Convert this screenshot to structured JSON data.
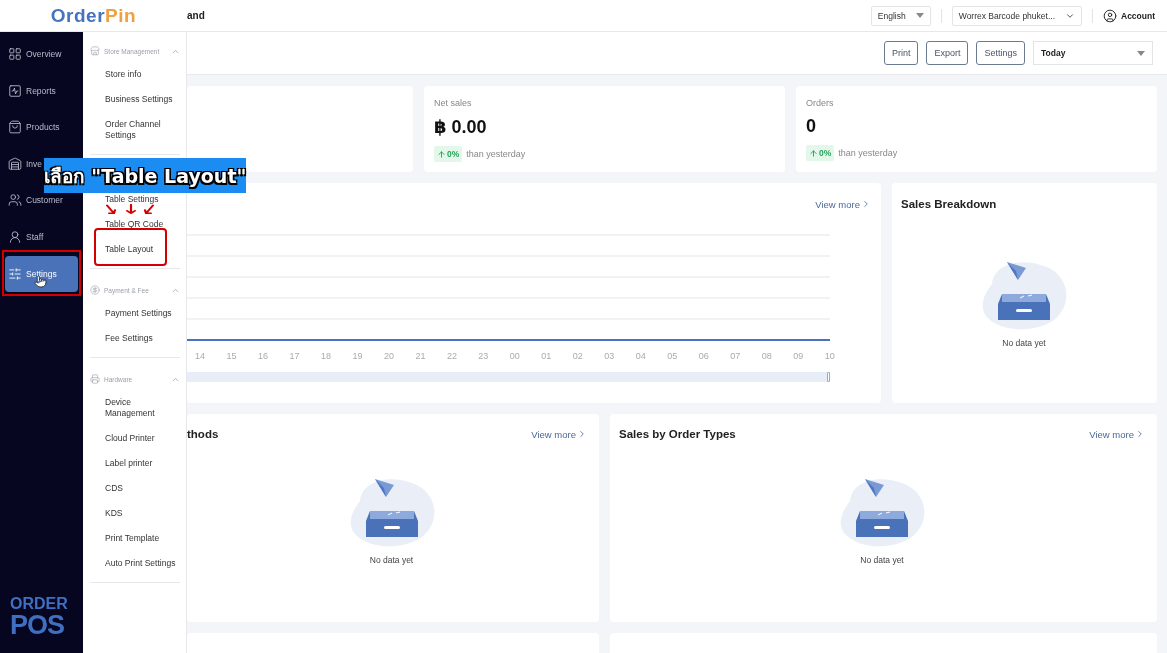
{
  "header": {
    "logo": [
      "Order",
      "Pin"
    ],
    "page_title": "and",
    "language": "English",
    "store": "Worrex Barcode phuket...",
    "account": "Account"
  },
  "sidebar": {
    "items": [
      {
        "label": "Overview",
        "selected": false
      },
      {
        "label": "Reports",
        "selected": false
      },
      {
        "label": "Products",
        "selected": false
      },
      {
        "label": "Inve",
        "selected": false
      },
      {
        "label": "Customer",
        "selected": false
      },
      {
        "label": "Staff",
        "selected": false
      },
      {
        "label": "Settings",
        "selected": true
      }
    ],
    "footer_logo": [
      "ORDER",
      "POS"
    ]
  },
  "submenu": {
    "groups": [
      {
        "title": "Store Management",
        "expanded": true,
        "items": [
          "Store info",
          "Business Settings",
          "Order Channel Settings"
        ]
      },
      {
        "items": [
          "Table Settings",
          "Table QR Code",
          "Table Layout"
        ]
      },
      {
        "title": "Payment & Fee",
        "expanded": true,
        "items": [
          "Payment Settings",
          "Fee Settings"
        ]
      },
      {
        "title": "Hardware",
        "expanded": true,
        "items": [
          "Device Management",
          "Cloud Printer",
          "Label printer",
          "CDS",
          "KDS",
          "Print Template",
          "Auto Print Settings"
        ]
      }
    ]
  },
  "toolbar": {
    "buttons": [
      "Print",
      "Export",
      "Settings"
    ],
    "period": "Today"
  },
  "stats": [
    {
      "kind": "blank"
    },
    {
      "kind": "metric",
      "label": "Net sales",
      "value": "฿ 0.00",
      "change": "0%",
      "note": "than yesterday"
    },
    {
      "kind": "metric",
      "label": "Orders",
      "value": "0",
      "change": "0%",
      "note": "than yesterday"
    }
  ],
  "trend_card": {
    "link": "View more",
    "x_labels": [
      "14",
      "15",
      "16",
      "17",
      "18",
      "19",
      "20",
      "21",
      "22",
      "23",
      "00",
      "01",
      "02",
      "03",
      "04",
      "05",
      "06",
      "07",
      "08",
      "09",
      "10"
    ]
  },
  "breakdown_card": {
    "title": "Sales Breakdown",
    "empty_text": "No data yet"
  },
  "panels": [
    {
      "title": "thods",
      "link": "View more",
      "empty_text": "No data yet"
    },
    {
      "title": "Sales by Order Types",
      "link": "View more",
      "empty_text": "No data yet"
    }
  ],
  "bottom_panels": [
    {
      "kind": "blank"
    },
    {
      "kind": "blank"
    }
  ],
  "annotation": {
    "caption": "เลือก \"Table Layout\""
  }
}
